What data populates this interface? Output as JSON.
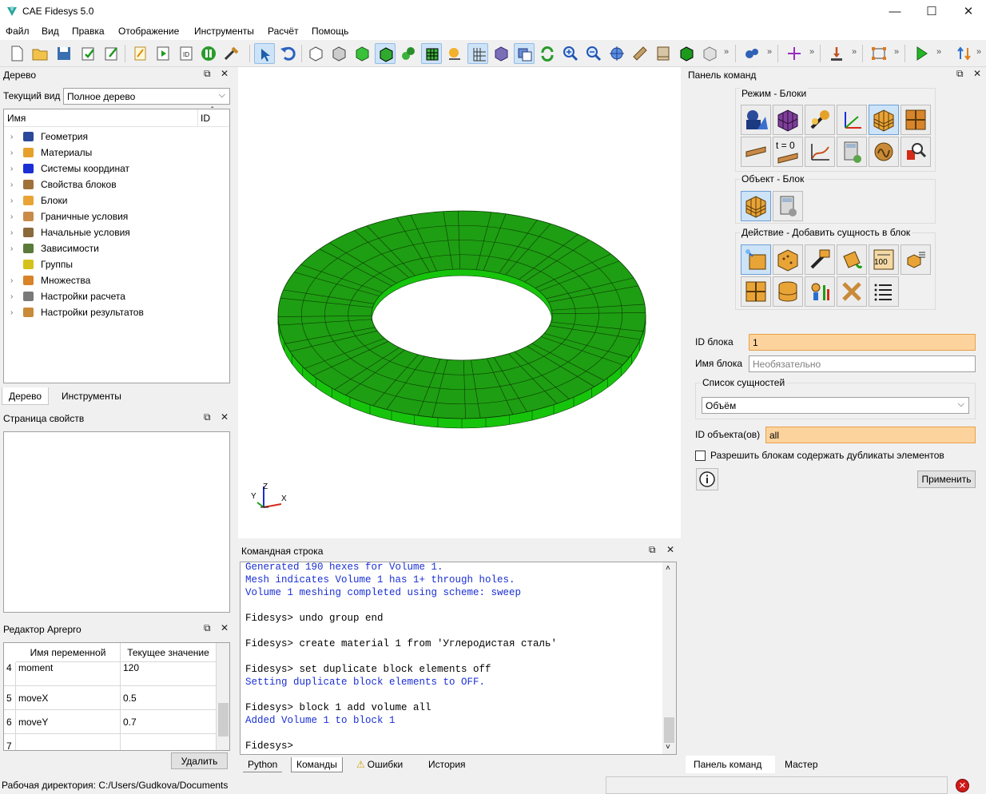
{
  "window": {
    "title": "CAE Fidesys 5.0",
    "minimize": "—",
    "maximize": "☐",
    "close": "✕"
  },
  "menu": [
    "Файл",
    "Вид",
    "Правка",
    "Отображение",
    "Инструменты",
    "Расчёт",
    "Помощь"
  ],
  "toolbar": {
    "overflow": "»"
  },
  "tree_panel": {
    "title": "Дерево",
    "current_view_label": "Текущий вид",
    "current_view_value": "Полное дерево",
    "col_name": "Имя",
    "col_id": "ID",
    "items": [
      {
        "label": "Геометрия",
        "icon": "geometry-icon"
      },
      {
        "label": "Материалы",
        "icon": "materials-icon"
      },
      {
        "label": "Системы координат",
        "icon": "coordinate-systems-icon"
      },
      {
        "label": "Свойства блоков",
        "icon": "block-properties-icon"
      },
      {
        "label": "Блоки",
        "icon": "blocks-icon"
      },
      {
        "label": "Граничные условия",
        "icon": "boundary-conditions-icon"
      },
      {
        "label": "Начальные условия",
        "icon": "initial-conditions-icon"
      },
      {
        "label": "Зависимости",
        "icon": "dependencies-icon"
      },
      {
        "label": "Группы",
        "icon": "groups-icon"
      },
      {
        "label": "Множества",
        "icon": "sets-icon"
      },
      {
        "label": "Настройки расчета",
        "icon": "calc-settings-icon"
      },
      {
        "label": "Настройки результатов",
        "icon": "results-settings-icon"
      }
    ],
    "tabs": [
      "Дерево",
      "Инструменты"
    ]
  },
  "properties_panel": {
    "title": "Страница свойств"
  },
  "aprepro_panel": {
    "title": "Редактор Aprepro",
    "col_var": "Имя переменной",
    "col_val": "Текущее значение",
    "rows": [
      {
        "n": "4",
        "name": "moment",
        "value": "120"
      },
      {
        "n": "5",
        "name": "moveX",
        "value": "0.5"
      },
      {
        "n": "6",
        "name": "moveY",
        "value": "0.7"
      },
      {
        "n": "7",
        "name": "",
        "value": ""
      }
    ],
    "delete_label": "Удалить"
  },
  "viewport": {
    "axis_z": "Z",
    "axis_y": "Y",
    "axis_x": "X"
  },
  "command_line": {
    "title": "Командная строка",
    "lines": [
      {
        "text": "Generated 190 hexes for Volume 1.",
        "kind": "out"
      },
      {
        "text": "Mesh indicates Volume 1 has 1+ through holes.",
        "kind": "out"
      },
      {
        "text": "Volume 1 meshing completed using scheme: sweep",
        "kind": "out"
      },
      {
        "text": "",
        "kind": "out"
      },
      {
        "text": "Fidesys> undo group end",
        "kind": "cmd"
      },
      {
        "text": "",
        "kind": "out"
      },
      {
        "text": "Fidesys> create material 1 from 'Углеродистая сталь'",
        "kind": "cmd"
      },
      {
        "text": "",
        "kind": "out"
      },
      {
        "text": "Fidesys> set duplicate block elements off",
        "kind": "cmd"
      },
      {
        "text": "Setting duplicate block elements to OFF.",
        "kind": "out"
      },
      {
        "text": "",
        "kind": "out"
      },
      {
        "text": "Fidesys> block 1 add volume all",
        "kind": "cmd"
      },
      {
        "text": "Added Volume 1 to block 1",
        "kind": "out"
      },
      {
        "text": "",
        "kind": "out"
      },
      {
        "text": "Fidesys> ",
        "kind": "cmd"
      }
    ],
    "tabs": [
      "Python",
      "Команды",
      "Ошибки",
      "История"
    ]
  },
  "command_panel": {
    "title": "Панель команд",
    "mode_title": "Режим - Блоки",
    "object_title": "Объект - Блок",
    "action_title": "Действие - Добавить сущность в блок",
    "block_id_label": "ID блока",
    "block_id_value": "1",
    "block_name_label": "Имя блока",
    "block_name_placeholder": "Необязательно",
    "entity_list_label": "Список сущностей",
    "entity_list_value": "Объём",
    "object_id_label": "ID объекта(ов)",
    "object_id_value": "all",
    "checkbox_label": "Разрешить блокам содержать дубликаты элементов",
    "apply_label": "Применить",
    "tabs": [
      "Панель команд",
      "Мастер"
    ],
    "mode_t0": "t = 0",
    "action_100": "100"
  },
  "status": {
    "workdir": "Рабочая директория: C:/Users/Gudkova/Documents"
  },
  "colors": {
    "mesh_green": "#1e9e12",
    "highlight_orange": "#fcd39c",
    "console_blue": "#1a2fd4"
  }
}
